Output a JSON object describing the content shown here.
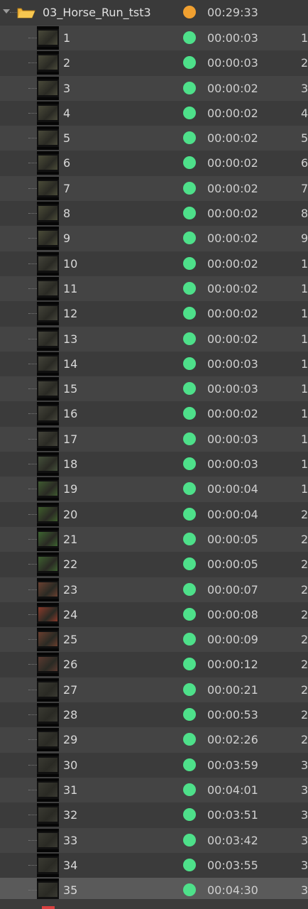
{
  "folder": {
    "name": "03_Horse_Run_tst3",
    "duration": "00:29:33",
    "status_color": "#f0a030",
    "icon": "folder-open-icon"
  },
  "item_status_color": "#4ee08a",
  "items": [
    {
      "label": "1",
      "duration": "00:00:03",
      "extra": "1",
      "thumb": "#4a4a3a"
    },
    {
      "label": "2",
      "duration": "00:00:03",
      "extra": "2",
      "thumb": "#4a4a3a"
    },
    {
      "label": "3",
      "duration": "00:00:02",
      "extra": "3",
      "thumb": "#4a4a3a"
    },
    {
      "label": "4",
      "duration": "00:00:02",
      "extra": "4",
      "thumb": "#4a4a3a"
    },
    {
      "label": "5",
      "duration": "00:00:02",
      "extra": "5",
      "thumb": "#4a4a3a"
    },
    {
      "label": "6",
      "duration": "00:00:02",
      "extra": "6",
      "thumb": "#4b4c38"
    },
    {
      "label": "7",
      "duration": "00:00:02",
      "extra": "7",
      "thumb": "#4b4c38"
    },
    {
      "label": "8",
      "duration": "00:00:02",
      "extra": "8",
      "thumb": "#4b4c38"
    },
    {
      "label": "9",
      "duration": "00:00:02",
      "extra": "9",
      "thumb": "#4b4c38"
    },
    {
      "label": "10",
      "duration": "00:00:02",
      "extra": "1",
      "thumb": "#44443a"
    },
    {
      "label": "11",
      "duration": "00:00:02",
      "extra": "1",
      "thumb": "#44443a"
    },
    {
      "label": "12",
      "duration": "00:00:02",
      "extra": "1",
      "thumb": "#44443a"
    },
    {
      "label": "13",
      "duration": "00:00:02",
      "extra": "1",
      "thumb": "#44443a"
    },
    {
      "label": "14",
      "duration": "00:00:03",
      "extra": "1",
      "thumb": "#44443a"
    },
    {
      "label": "15",
      "duration": "00:00:03",
      "extra": "1",
      "thumb": "#44443a"
    },
    {
      "label": "16",
      "duration": "00:00:02",
      "extra": "1",
      "thumb": "#44443a"
    },
    {
      "label": "17",
      "duration": "00:00:03",
      "extra": "1",
      "thumb": "#44443a"
    },
    {
      "label": "18",
      "duration": "00:00:03",
      "extra": "1",
      "thumb": "#44503a"
    },
    {
      "label": "19",
      "duration": "00:00:04",
      "extra": "1",
      "thumb": "#3f5a30"
    },
    {
      "label": "20",
      "duration": "00:00:04",
      "extra": "2",
      "thumb": "#3f5e2c"
    },
    {
      "label": "21",
      "duration": "00:00:05",
      "extra": "2",
      "thumb": "#3d6430"
    },
    {
      "label": "22",
      "duration": "00:00:05",
      "extra": "2",
      "thumb": "#3e6030"
    },
    {
      "label": "23",
      "duration": "00:00:07",
      "extra": "2",
      "thumb": "#6a4030"
    },
    {
      "label": "24",
      "duration": "00:00:08",
      "extra": "2",
      "thumb": "#8a3a2a"
    },
    {
      "label": "25",
      "duration": "00:00:09",
      "extra": "2",
      "thumb": "#6a3e2e"
    },
    {
      "label": "26",
      "duration": "00:00:12",
      "extra": "2",
      "thumb": "#5a3a30"
    },
    {
      "label": "27",
      "duration": "00:00:21",
      "extra": "2",
      "thumb": "#3a3a32"
    },
    {
      "label": "28",
      "duration": "00:00:53",
      "extra": "2",
      "thumb": "#3a3a32"
    },
    {
      "label": "29",
      "duration": "00:02:26",
      "extra": "2",
      "thumb": "#3a3a32"
    },
    {
      "label": "30",
      "duration": "00:03:59",
      "extra": "3",
      "thumb": "#3a3a32"
    },
    {
      "label": "31",
      "duration": "00:04:01",
      "extra": "3",
      "thumb": "#3a3a32"
    },
    {
      "label": "32",
      "duration": "00:03:51",
      "extra": "3",
      "thumb": "#3a3a32"
    },
    {
      "label": "33",
      "duration": "00:03:42",
      "extra": "3",
      "thumb": "#3a3a32"
    },
    {
      "label": "34",
      "duration": "00:03:55",
      "extra": "3",
      "thumb": "#3a3a32"
    },
    {
      "label": "35",
      "duration": "00:04:30",
      "extra": "3",
      "thumb": "#3a3a32",
      "selected": true
    }
  ]
}
